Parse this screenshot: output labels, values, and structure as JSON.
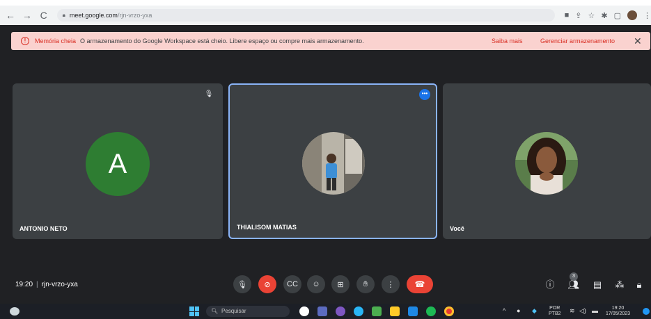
{
  "browser": {
    "url_host": "meet.google.com",
    "url_path": "/rjn-vrzo-yxa"
  },
  "banner": {
    "title": "Memória cheia",
    "message": "O armazenamento do Google Workspace está cheio. Libere espaço ou compre mais armazenamento.",
    "link_learn_more": "Saiba mais",
    "link_manage": "Gerenciar armazenamento",
    "close_glyph": "✕",
    "accent_color": "#d93025"
  },
  "participants": [
    {
      "name": "ANTONIO NETO",
      "avatar_initial": "A",
      "avatar_color": "#2e7d32",
      "mic_muted": true
    },
    {
      "name": "THIALISOM MATIAS",
      "active_speaker": true
    },
    {
      "name": "Você"
    }
  ],
  "meeting": {
    "time": "19:20",
    "separator": "|",
    "code": "rjn-vrzo-yxa",
    "people_count": "3"
  },
  "taskbar": {
    "search_placeholder": "Pesquisar",
    "lang_top": "POR",
    "lang_bottom": "PTB2",
    "clock_time": "19:20",
    "clock_date": "17/05/2023"
  }
}
